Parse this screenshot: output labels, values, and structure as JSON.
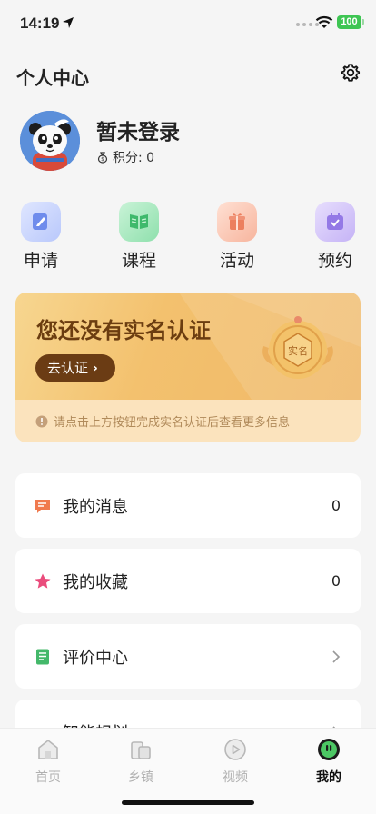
{
  "status": {
    "time": "14:19",
    "battery": "100"
  },
  "header": {
    "title": "个人中心"
  },
  "profile": {
    "name": "暂未登录",
    "points_label": "积分: 0"
  },
  "quick_actions": [
    {
      "label": "申请",
      "icon": "edit-icon",
      "color": "#7b93ef"
    },
    {
      "label": "课程",
      "icon": "book-icon",
      "color": "#47c47a"
    },
    {
      "label": "活动",
      "icon": "gift-icon",
      "color": "#f08a6e"
    },
    {
      "label": "预约",
      "icon": "calendar-icon",
      "color": "#9b82ea"
    }
  ],
  "verify": {
    "title": "您还没有实名认证",
    "button": "去认证",
    "badge_text": "实名",
    "note": "请点击上方按钮完成实名认证后查看更多信息"
  },
  "list": [
    {
      "label": "我的消息",
      "value": "0",
      "icon": "message-icon"
    },
    {
      "label": "我的收藏",
      "value": "0",
      "icon": "star-icon"
    },
    {
      "label": "评价中心",
      "value": "",
      "icon": "document-icon"
    },
    {
      "label": "智能规划",
      "value": "",
      "icon": "plan-icon"
    }
  ],
  "tabs": [
    {
      "label": "首页",
      "icon": "home-icon"
    },
    {
      "label": "乡镇",
      "icon": "town-icon"
    },
    {
      "label": "视频",
      "icon": "play-icon"
    },
    {
      "label": "我的",
      "icon": "profile-icon"
    }
  ],
  "active_tab": "我的"
}
